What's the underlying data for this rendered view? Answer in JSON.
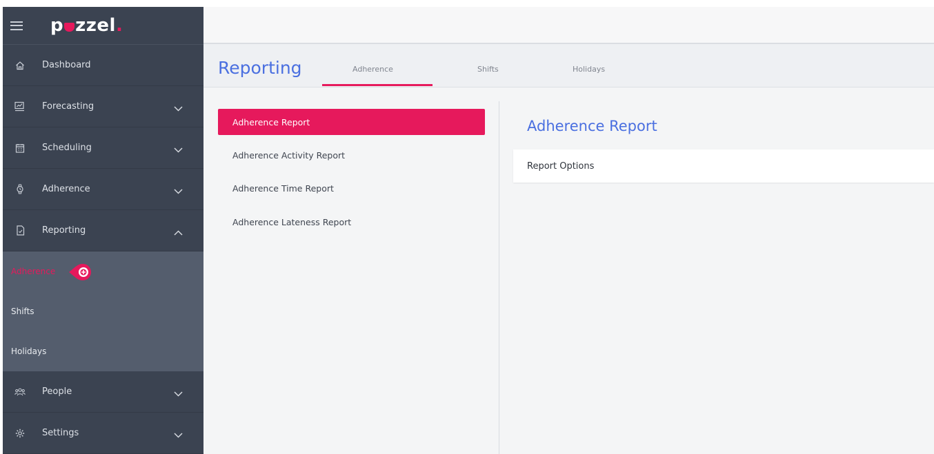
{
  "brand": {
    "logo_text_start": "p",
    "logo_text_end": "zzel",
    "logo_dot": "."
  },
  "sidebar": {
    "items": [
      {
        "label": "Dashboard",
        "icon": "home-icon",
        "has_chevron": false
      },
      {
        "label": "Forecasting",
        "icon": "forecast-chart-icon",
        "chevron": "down"
      },
      {
        "label": "Scheduling",
        "icon": "calendar-icon",
        "chevron": "down"
      },
      {
        "label": "Adherence",
        "icon": "watch-icon",
        "chevron": "down"
      },
      {
        "label": "Reporting",
        "icon": "report-doc-icon",
        "chevron": "up"
      },
      {
        "label": "People",
        "icon": "people-icon",
        "chevron": "down"
      },
      {
        "label": "Settings",
        "icon": "gear-icon",
        "chevron": "down"
      }
    ],
    "reporting_sub": [
      {
        "label": "Adherence",
        "active": true
      },
      {
        "label": "Shifts",
        "active": false
      },
      {
        "label": "Holidays",
        "active": false
      }
    ]
  },
  "main": {
    "title": "Reporting",
    "tabs": [
      {
        "label": "Adherence",
        "active": true
      },
      {
        "label": "Shifts",
        "active": false
      },
      {
        "label": "Holidays",
        "active": false
      }
    ],
    "reports": [
      {
        "label": "Adherence Report",
        "active": true
      },
      {
        "label": "Adherence Activity Report",
        "active": false
      },
      {
        "label": "Adherence Time Report",
        "active": false
      },
      {
        "label": "Adherence Lateness Report",
        "active": false
      }
    ],
    "detail": {
      "title": "Adherence Report",
      "options_label": "Report Options"
    }
  },
  "colors": {
    "accent": "#e6195c",
    "title_blue": "#4a6fe0",
    "sidebar_bg": "#3b4351",
    "submenu_bg": "#545d6d"
  }
}
